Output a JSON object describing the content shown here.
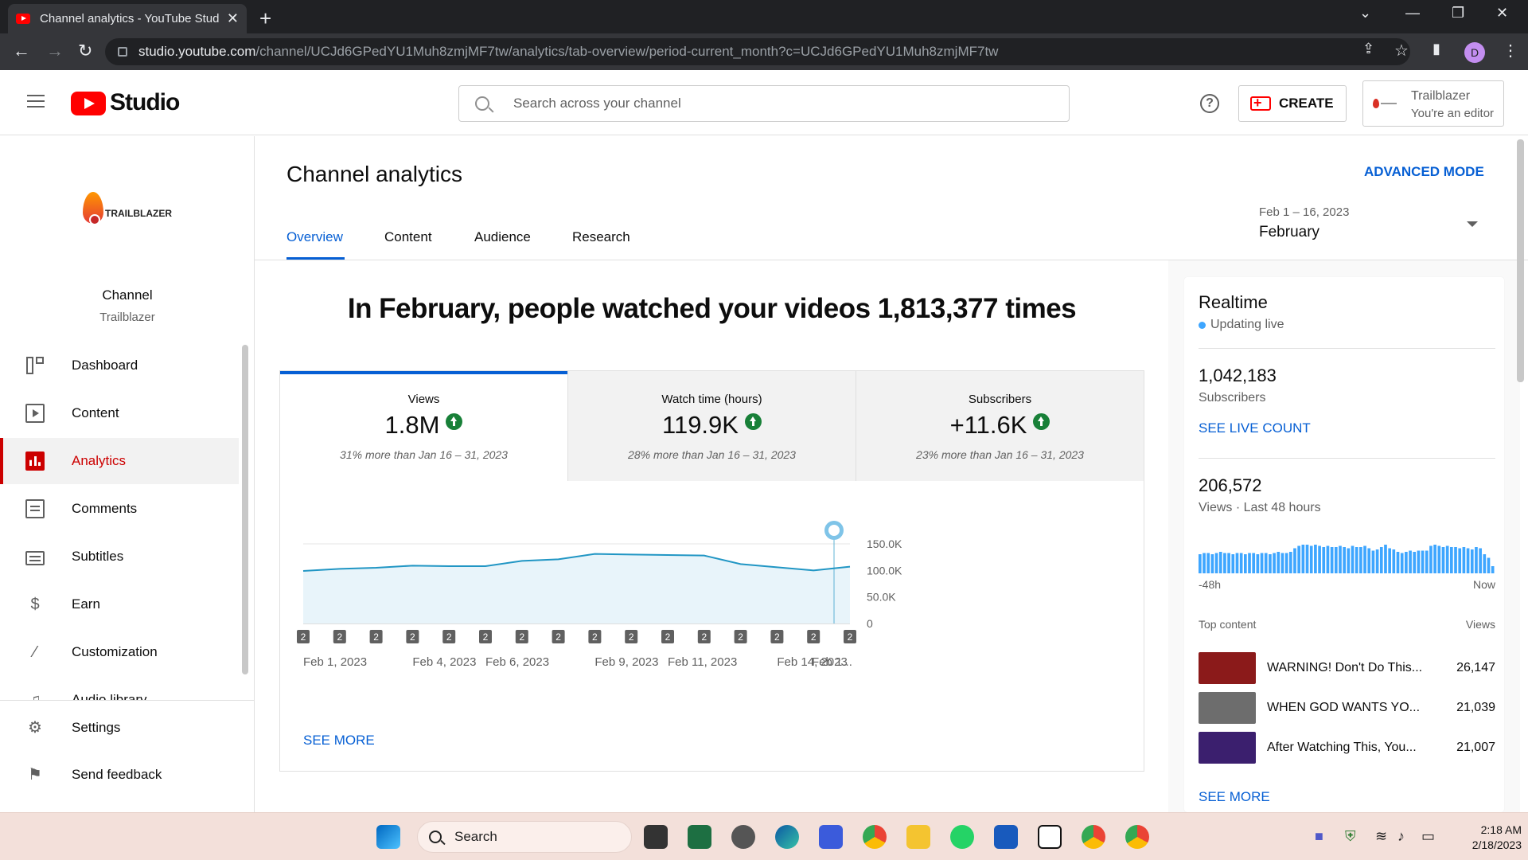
{
  "browser": {
    "tab_title": "Channel analytics - YouTube Studio",
    "url_host": "studio.youtube.com",
    "url_path": "/channel/UCJd6GPedYU1Muh8zmjMF7tw/analytics/tab-overview/period-current_month?c=UCJd6GPedYU1Muh8zmjMF7tw",
    "profile_initial": "D"
  },
  "header": {
    "logo_text": "Studio",
    "search_placeholder": "Search across your channel",
    "create_label": "CREATE",
    "account_name": "Trailblazer",
    "account_role": "You're an editor"
  },
  "sidebar": {
    "logo_text": "TRAILBLAZER",
    "channel_label": "Channel",
    "channel_name": "Trailblazer",
    "items": [
      {
        "label": "Dashboard",
        "icon": "dashboard-icon"
      },
      {
        "label": "Content",
        "icon": "content-icon"
      },
      {
        "label": "Analytics",
        "icon": "analytics-icon"
      },
      {
        "label": "Comments",
        "icon": "comments-icon"
      },
      {
        "label": "Subtitles",
        "icon": "subtitles-icon"
      },
      {
        "label": "Earn",
        "icon": "dollar-icon"
      },
      {
        "label": "Customization",
        "icon": "magic-wand-icon"
      },
      {
        "label": "Audio library",
        "icon": "audio-library-icon"
      }
    ],
    "bottom_items": [
      {
        "label": "Settings",
        "icon": "gear-icon"
      },
      {
        "label": "Send feedback",
        "icon": "feedback-icon"
      }
    ]
  },
  "main": {
    "title": "Channel analytics",
    "advanced_mode": "ADVANCED MODE",
    "tabs": [
      "Overview",
      "Content",
      "Audience",
      "Research"
    ],
    "date_range": "Feb 1 – 16, 2023",
    "date_label": "February",
    "headline": "In February, people watched your videos 1,813,377 times",
    "metrics": [
      {
        "label": "Views",
        "value": "1.8M",
        "comparison": "31% more than Jan 16 – 31, 2023"
      },
      {
        "label": "Watch time (hours)",
        "value": "119.9K",
        "comparison": "28% more than Jan 16 – 31, 2023"
      },
      {
        "label": "Subscribers",
        "value": "+11.6K",
        "comparison": "23% more than Jan 16 – 31, 2023"
      }
    ],
    "see_more": "SEE MORE"
  },
  "chart_data": {
    "type": "area",
    "series": [
      {
        "values": [
          99000,
          103000,
          105000,
          109000,
          108000,
          108000,
          118000,
          121000,
          131000,
          130000,
          129000,
          128000,
          112000,
          106000,
          100000,
          107000
        ]
      }
    ],
    "x": [
      "Feb 1",
      "Feb 2",
      "Feb 3",
      "Feb 4",
      "Feb 5",
      "Feb 6",
      "Feb 7",
      "Feb 8",
      "Feb 9",
      "Feb 10",
      "Feb 11",
      "Feb 12",
      "Feb 13",
      "Feb 14",
      "Feb 15",
      "Feb 16"
    ],
    "x_tick_labels": [
      "Feb 1, 2023",
      "Feb 4, 2023",
      "Feb 6, 2023",
      "Feb 9, 2023",
      "Feb 11, 2023",
      "Feb 14, 2023",
      "Feb 1..."
    ],
    "y_ticks": [
      "150.0K",
      "100.0K",
      "50.0K",
      "0"
    ],
    "ylim": [
      0,
      150000
    ],
    "marker_label": "2",
    "line_color": "#2196c4",
    "fill_color": "#e8f4fa"
  },
  "realtime": {
    "title": "Realtime",
    "status": "Updating live",
    "subscribers_value": "1,042,183",
    "subscribers_label": "Subscribers",
    "see_live_count": "SEE LIVE COUNT",
    "views_value": "206,572",
    "views_label": "Views · Last 48 hours",
    "axis_start": "-48h",
    "axis_end": "Now",
    "bar_values": [
      16,
      17,
      17,
      16,
      17,
      18,
      17,
      17,
      16,
      17,
      17,
      16,
      17,
      17,
      16,
      17,
      17,
      16,
      17,
      18,
      17,
      17,
      18,
      21,
      23,
      24,
      24,
      23,
      24,
      23,
      22,
      23,
      22,
      22,
      23,
      22,
      21,
      23,
      22,
      22,
      23,
      21,
      19,
      20,
      22,
      24,
      21,
      20,
      18,
      17,
      18,
      19,
      18,
      19,
      19,
      19,
      23,
      24,
      23,
      22,
      23,
      22,
      22,
      21,
      22,
      21,
      20,
      22,
      21,
      16,
      13,
      6
    ],
    "top_content_label": "Top content",
    "views_column_label": "Views",
    "top_content": [
      {
        "title": "WARNING! Don't Do This...",
        "views": "26,147",
        "thumb_color": "#8b1a1a"
      },
      {
        "title": "WHEN GOD WANTS YO...",
        "views": "21,039",
        "thumb_color": "#6d6d6d"
      },
      {
        "title": "After Watching This, You...",
        "views": "21,007",
        "thumb_color": "#3b1f6e"
      }
    ],
    "see_more": "SEE MORE"
  },
  "taskbar": {
    "search_label": "Search",
    "time": "2:18 AM",
    "date": "2/18/2023"
  }
}
